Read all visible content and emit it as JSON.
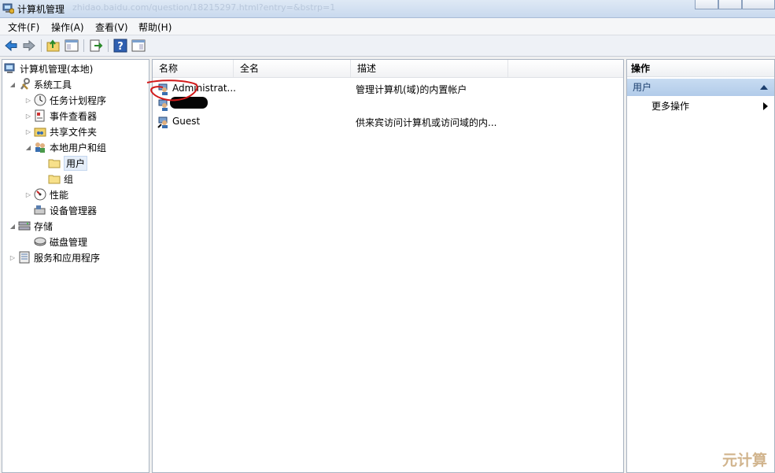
{
  "window": {
    "title": "计算机管理",
    "ghost_url": "zhidao.baidu.com/question/18215297.html?entry=&bstrp=1"
  },
  "menubar": {
    "items": [
      "文件(F)",
      "操作(A)",
      "查看(V)",
      "帮助(H)"
    ]
  },
  "toolbar": {
    "buttons": [
      "back-arrow-icon",
      "forward-arrow-icon",
      "up-folder-icon",
      "show-hide-tree-icon",
      "export-list-icon",
      "help-icon",
      "show-hide-action-pane-icon"
    ]
  },
  "tree": {
    "items": [
      {
        "label": "计算机管理(本地)",
        "expander": ""
      },
      {
        "label": "系统工具",
        "expander": "◢"
      },
      {
        "label": "任务计划程序",
        "expander": "▷"
      },
      {
        "label": "事件查看器",
        "expander": "▷"
      },
      {
        "label": "共享文件夹",
        "expander": "▷"
      },
      {
        "label": "本地用户和组",
        "expander": "◢"
      },
      {
        "label": "用户",
        "expander": ""
      },
      {
        "label": "组",
        "expander": ""
      },
      {
        "label": "性能",
        "expander": "▷"
      },
      {
        "label": "设备管理器",
        "expander": ""
      },
      {
        "label": "存储",
        "expander": "◢"
      },
      {
        "label": "磁盘管理",
        "expander": ""
      },
      {
        "label": "服务和应用程序",
        "expander": "▷"
      }
    ]
  },
  "list": {
    "columns": [
      "名称",
      "全名",
      "描述"
    ],
    "rows": [
      {
        "name": "Administrat...",
        "full_name": "",
        "description": "管理计算机(域)的内置帐户"
      },
      {
        "name": "",
        "full_name": "",
        "description": ""
      },
      {
        "name": "Guest",
        "full_name": "",
        "description": "供来宾访问计算机或访问域的内..."
      }
    ]
  },
  "actions": {
    "title": "操作",
    "section": "用户",
    "items": [
      "更多操作"
    ]
  },
  "watermark": "元计算",
  "colors": {
    "accent": "#b2cbe9",
    "annotation_red": "#d21a1a"
  }
}
